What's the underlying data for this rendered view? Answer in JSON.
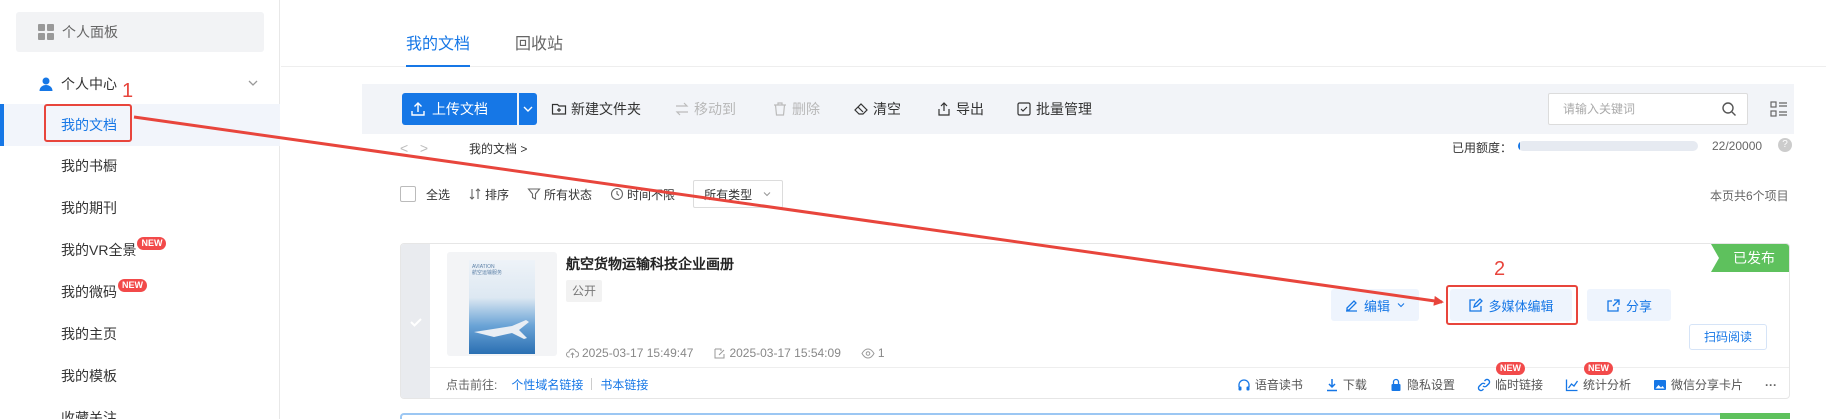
{
  "sidebar": {
    "panel_label": "个人面板",
    "center_label": "个人中心",
    "items": [
      {
        "label": "我的文档",
        "new": false
      },
      {
        "label": "我的书橱",
        "new": false
      },
      {
        "label": "我的期刊",
        "new": false
      },
      {
        "label": "我的VR全景",
        "new": true
      },
      {
        "label": "我的微码",
        "new": true
      },
      {
        "label": "我的主页",
        "new": false
      },
      {
        "label": "我的模板",
        "new": false
      },
      {
        "label": "收藏关注",
        "new": false
      }
    ],
    "new_badge": "NEW"
  },
  "tabs": [
    {
      "label": "我的文档",
      "active": true
    },
    {
      "label": "回收站",
      "active": false
    }
  ],
  "toolbar": {
    "upload_label": "上传文档",
    "new_folder_label": "新建文件夹",
    "move_label": "移动到",
    "delete_label": "删除",
    "clear_label": "清空",
    "export_label": "导出",
    "batch_label": "批量管理",
    "search_placeholder": "请输入关键词"
  },
  "breadcrumb": {
    "path": "我的文档",
    "separator": ">"
  },
  "quota": {
    "label": "已用额度：",
    "used": 22,
    "total": 20000,
    "text": "22/20000"
  },
  "filters": {
    "select_all": "全选",
    "sort": "排序",
    "status": "所有状态",
    "time": "时间不限",
    "type": "所有类型",
    "page_count": "本页共6个项目"
  },
  "document": {
    "title": "航空货物运输科技企业画册",
    "visibility": "公开",
    "created": "2025-03-17 15:49:47",
    "modified": "2025-03-17 15:54:09",
    "views": "1",
    "status": "已发布",
    "thumb_lines": [
      "AVIATION",
      "航空运输服务"
    ],
    "edit_label": "编辑",
    "multimedia_label": "多媒体编辑",
    "share_label": "分享",
    "scan_label": "扫码阅读",
    "foot_label": "点击前往:",
    "foot_links": [
      "个性域名链接",
      "书本链接"
    ],
    "foot_tools": [
      {
        "label": "语音读书",
        "icon": "headphone-icon",
        "new": false
      },
      {
        "label": "下载",
        "icon": "download-icon",
        "new": false
      },
      {
        "label": "隐私设置",
        "icon": "lock-icon",
        "new": false
      },
      {
        "label": "临时链接",
        "icon": "link-icon",
        "new": true
      },
      {
        "label": "统计分析",
        "icon": "chart-icon",
        "new": true
      },
      {
        "label": "微信分享卡片",
        "icon": "image-icon",
        "new": false
      }
    ],
    "more": "···"
  },
  "annotations": {
    "label_1": "1",
    "label_2": "2",
    "color": "#e8453c"
  },
  "colors": {
    "primary": "#1677e6",
    "published": "#5ec15d",
    "badge": "#f24a4a"
  }
}
